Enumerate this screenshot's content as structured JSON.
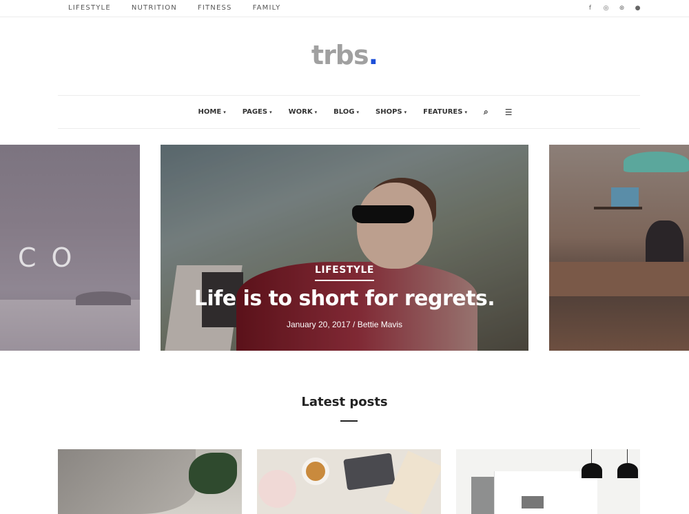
{
  "topnav": {
    "items": [
      "LIFESTYLE",
      "NUTRITION",
      "FITNESS",
      "FAMILY"
    ]
  },
  "social": {
    "icons": [
      "facebook-icon",
      "instagram-icon",
      "dribbble-icon",
      "github-icon"
    ],
    "glyphs": [
      "f",
      "◎",
      "⊛",
      "●"
    ]
  },
  "logo": {
    "text": "trbs",
    "dot": ".",
    "accent_color": "#1d4fd8"
  },
  "mainnav": {
    "items": [
      "HOME",
      "PAGES",
      "WORK",
      "BLOG",
      "SHOPS",
      "FEATURES"
    ],
    "search_glyph": "⌕",
    "menu_glyph": "☰"
  },
  "slider": {
    "left_text": "CO",
    "featured": {
      "category": "LIFESTYLE",
      "title": "Life is to short for regrets.",
      "meta": "January 20, 2017 / Bettie Mavis"
    }
  },
  "latest": {
    "heading": "Latest posts"
  }
}
